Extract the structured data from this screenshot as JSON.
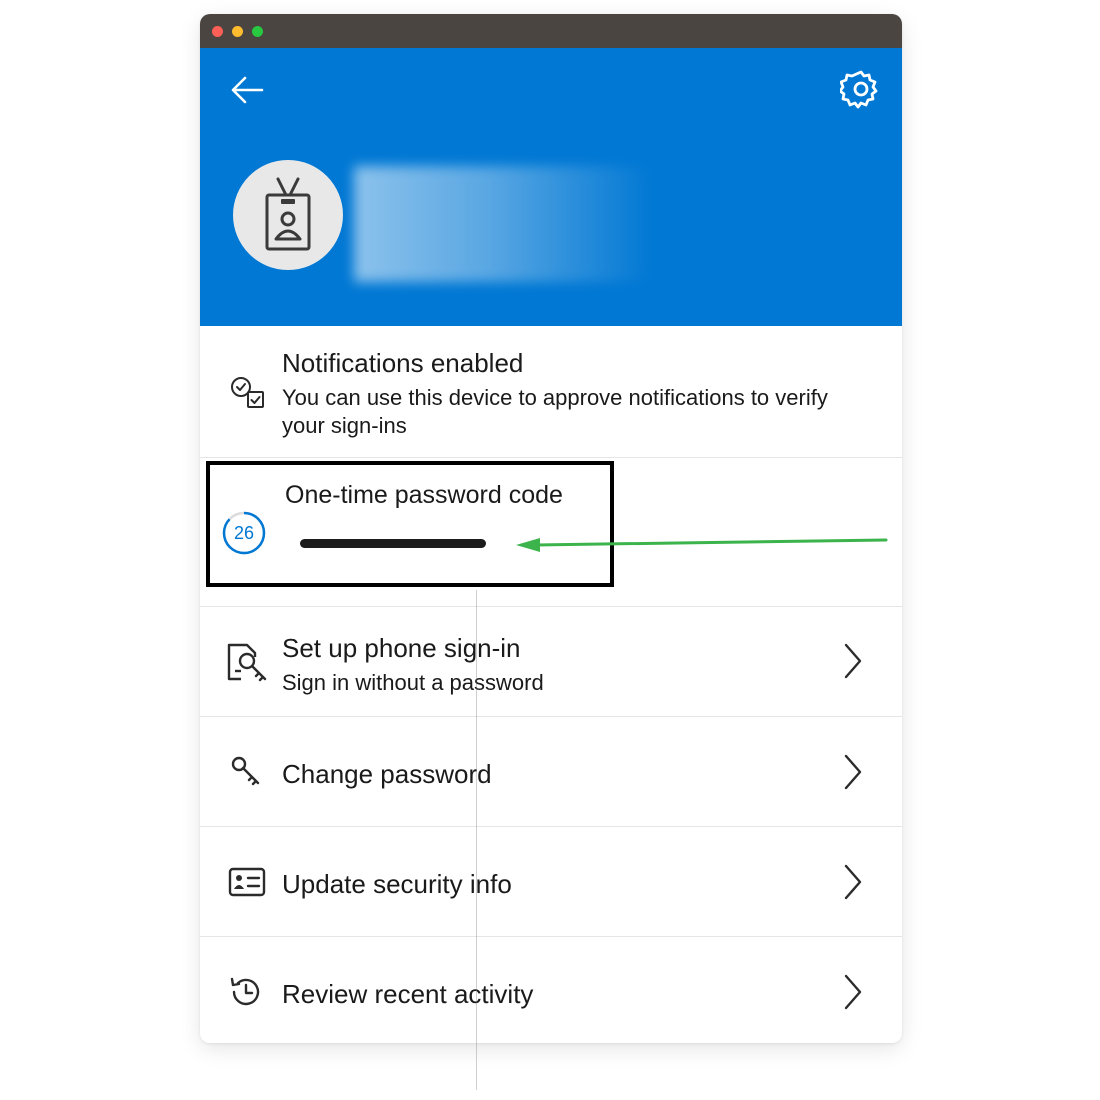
{
  "header": {
    "back_icon": "arrow-left-icon",
    "settings_icon": "gear-icon",
    "avatar_icon": "id-badge-icon",
    "background_color": "#0078d4"
  },
  "items": {
    "notifications": {
      "title": "Notifications enabled",
      "subtitle": "You can use this device to approve notifications to verify your sign-ins",
      "icon": "notification-check-icon"
    },
    "otp": {
      "title": "One-time password code",
      "timer": "26",
      "timer_fraction": 0.87,
      "icon": "timer-ring-icon"
    },
    "phone_signin": {
      "title": "Set up phone sign-in",
      "subtitle": "Sign in without a password",
      "icon": "phone-key-icon"
    },
    "change_password": {
      "title": "Change password",
      "icon": "key-icon"
    },
    "security_info": {
      "title": "Update security info",
      "icon": "contact-card-icon"
    },
    "recent_activity": {
      "title": "Review recent activity",
      "icon": "history-icon"
    }
  },
  "annotation": {
    "arrow_color": "#3cb44b",
    "highlight_border_color": "#000000"
  }
}
